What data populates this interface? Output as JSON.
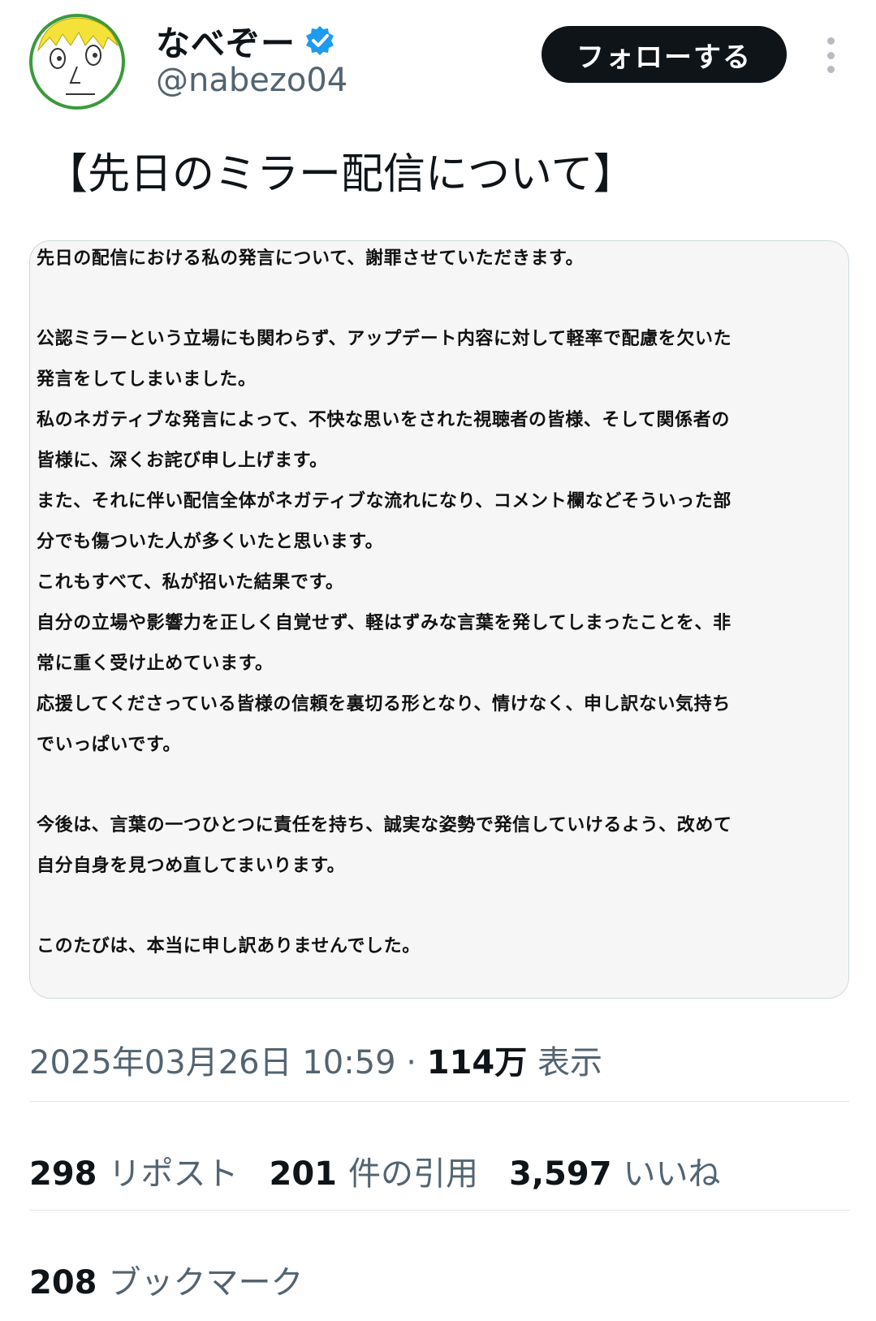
{
  "author": {
    "display_name": "なべぞー",
    "handle": "@nabezo04",
    "avatar": "cartoon-face-avatar",
    "verified_icon": "verified-badge-icon",
    "verified_color": "#1d9bf0"
  },
  "actions": {
    "follow_label": "フォローする",
    "more_icon": "more-vertical-icon"
  },
  "tweet": {
    "text": "【先日のミラー配信について】"
  },
  "statement_lines": [
    "先日の配信における私の発言について、謝罪させていただきます。",
    "",
    "公認ミラーという立場にも関わらず、アップデート内容に対して軽率で配慮を欠いた",
    "発言をしてしまいました。",
    "私のネガティブな発言によって、不快な思いをされた視聴者の皆様、そして関係者の",
    "皆様に、深くお詫び申し上げます。",
    "また、それに伴い配信全体がネガティブな流れになり、コメント欄などそういった部",
    "分でも傷ついた人が多くいたと思います。",
    "これもすべて、私が招いた結果です。",
    "自分の立場や影響力を正しく自覚せず、軽はずみな言葉を発してしまったことを、非",
    "常に重く受け止めています。",
    "応援してくださっている皆様の信頼を裏切る形となり、情けなく、申し訳ない気持ち",
    "でいっぱいです。",
    "",
    "今後は、言葉の一つひとつに責任を持ち、誠実な姿勢で発信していけるよう、改めて",
    "自分自身を見つめ直してまいります。",
    "",
    "このたびは、本当に申し訳ありませんでした。"
  ],
  "meta": {
    "timestamp": "2025年03月26日 10:59",
    "separator": " · ",
    "views_count": "114万",
    "views_label": " 表示"
  },
  "stats": {
    "reposts": {
      "count": "298",
      "label": "リポスト"
    },
    "quotes": {
      "count": "201",
      "label": "件の引用"
    },
    "likes": {
      "count": "3,597",
      "label": "いいね"
    },
    "bookmarks": {
      "count": "208",
      "label": "ブックマーク"
    }
  },
  "colors": {
    "text_primary": "#0f1419",
    "text_secondary": "#536471",
    "button_bg": "#0f1419",
    "divider": "#dfe5e9"
  }
}
